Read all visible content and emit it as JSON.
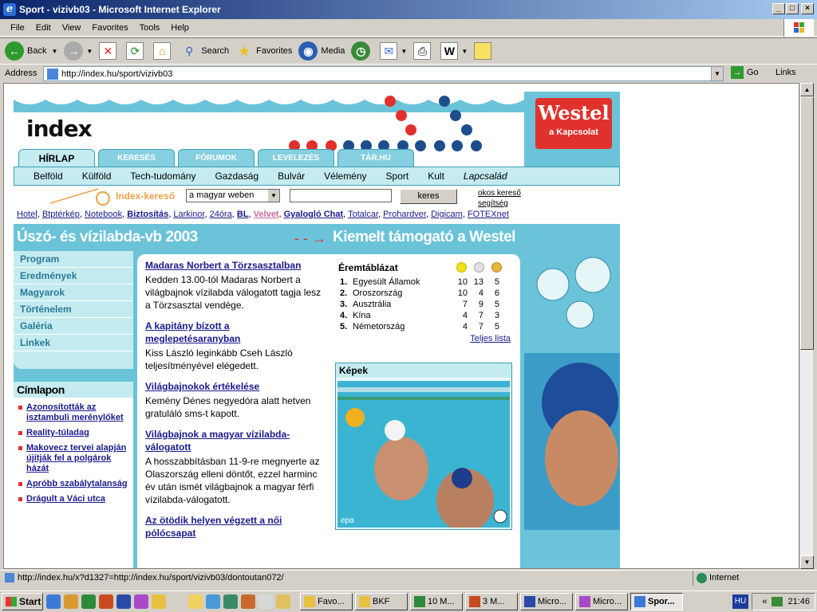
{
  "window": {
    "title": "Sport - vizivb03 - Microsoft Internet Explorer"
  },
  "menu": [
    "File",
    "Edit",
    "View",
    "Favorites",
    "Tools",
    "Help"
  ],
  "toolbar": {
    "back": "Back",
    "search": "Search",
    "favorites": "Favorites",
    "media": "Media"
  },
  "address": {
    "label": "Address",
    "url": "http://index.hu/sport/vizivb03",
    "go": "Go",
    "links": "Links"
  },
  "site": {
    "logo": "index",
    "westel_brand": "Westel",
    "westel_tagline": "a Kapcsolat",
    "tabs": [
      "HÍRLAP",
      "KERESÉS",
      "FÓRUMOK",
      "LEVELEZÉS",
      "TÁR.HU"
    ],
    "nav": [
      "Belföld",
      "Külföld",
      "Tech-tudomány",
      "Gazdaság",
      "Bulvár",
      "Vélemény",
      "Sport",
      "Kult",
      "Lapcsalád"
    ],
    "search": {
      "label": "Index-kereső",
      "scope": "a magyar weben",
      "button": "keres",
      "smart": "okos kereső",
      "help": "segítség"
    },
    "partners": [
      "Hotel",
      "Btptérkép",
      "Notebook",
      "Biztosítás",
      "Larkinor",
      "24óra",
      "BL",
      "Velvet",
      "Gyalogló Chat",
      "Totalcar",
      "Prohardver",
      "Digicam",
      "FOTEXnet"
    ],
    "banner_title": "Úszó- és vízilabda-vb 2003",
    "banner_sponsor": "Kiemelt támogató a Westel",
    "left_menu": [
      "Program",
      "Eredmények",
      "Magyarok",
      "Történelem",
      "Galéria",
      "Linkek"
    ],
    "cimlapon": {
      "title": "Címlapon",
      "items": [
        "Azonosították az isztambuli merénylőket",
        "Reality-túladag",
        "Makovecz tervei alapján újítják fel a polgárok házát",
        "Apróbb szabálytalanság",
        "Drágult a Váci utca"
      ]
    },
    "news": [
      {
        "title": "Madaras Norbert a Törzsasztalban",
        "body": "Kedden 13.00-tól Madaras Norbert a világbajnok vízilabda válogatott tagja lesz a Törzsasztal vendége."
      },
      {
        "title": "A kapitány bízott a meglepetésaranyban",
        "body": "Kiss László leginkább Cseh László teljesítményével elégedett."
      },
      {
        "title": "Világbajnokok értékelése",
        "body": "Kemény Dénes negyedóra alatt hetven gratuláló sms-t kapott."
      },
      {
        "title": "Világbajnok a magyar vízilabda-válogatott",
        "body": "A hosszabbításban 11-9-re megnyerte az Olaszország elleni döntőt, ezzel harminc év után ismét világbajnok a magyar férfi vízilabda-válogatott."
      },
      {
        "title": "Az ötödik helyen végzett a női pólócsapat",
        "body": ""
      }
    ],
    "medals": {
      "title": "Éremtáblázat",
      "rows": [
        {
          "rank": "1.",
          "country": "Egyesült Államok",
          "gold": "10",
          "silver": "13",
          "bronze": "5"
        },
        {
          "rank": "2.",
          "country": "Oroszország",
          "gold": "10",
          "silver": "4",
          "bronze": "6"
        },
        {
          "rank": "3.",
          "country": "Ausztrália",
          "gold": "7",
          "silver": "9",
          "bronze": "5"
        },
        {
          "rank": "4.",
          "country": "Kína",
          "gold": "4",
          "silver": "7",
          "bronze": "3"
        },
        {
          "rank": "5.",
          "country": "Németország",
          "gold": "4",
          "silver": "7",
          "bronze": "5"
        }
      ],
      "full": "Teljes lista",
      "colors": {
        "gold": "#f2e01a",
        "silver": "#d8d8d8",
        "bronze": "#e8b440"
      }
    },
    "kepek": {
      "title": "Képek",
      "credit": "epa"
    }
  },
  "status": {
    "text": "http://index.hu/x?d1327=http://index.hu/sport/vizivb03/dontoutan072/",
    "zone": "Internet"
  },
  "taskbar": {
    "start": "Start",
    "tasks": [
      "Favo...",
      "BKF",
      "10 M...",
      "3 M...",
      "Micro...",
      "Micro...",
      "Spor..."
    ],
    "lang": "HU",
    "time": "21:46"
  },
  "colors": {
    "site_blue": "#6ac3d8",
    "light": "#c4ebf0",
    "westel_red": "#e1312c",
    "link": "#1a1a8c"
  }
}
